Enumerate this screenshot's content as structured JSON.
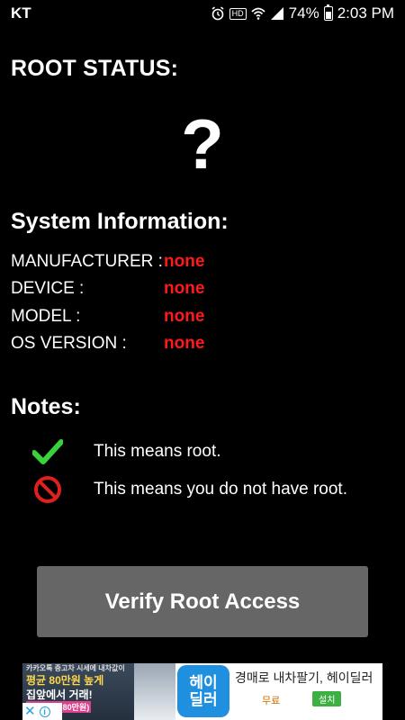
{
  "status_bar": {
    "carrier": "KT",
    "hd_label": "HD",
    "battery_percent": "74%",
    "battery_level": 0.74,
    "time": "2:03 PM"
  },
  "root_status": {
    "title": "ROOT STATUS:",
    "symbol": "?"
  },
  "system_info": {
    "title": "System Information:",
    "rows": [
      {
        "key": "MANUFACTURER :",
        "value": "none"
      },
      {
        "key": "DEVICE :",
        "value": "none"
      },
      {
        "key": "MODEL :",
        "value": "none"
      },
      {
        "key": "OS VERSION :",
        "value": "none"
      }
    ]
  },
  "notes": {
    "title": "Notes:",
    "items": [
      {
        "icon": "green-check-icon",
        "text": "This means root."
      },
      {
        "icon": "red-prohibited-icon",
        "text": "This means you do not have root."
      }
    ]
  },
  "verify_button": {
    "label": "Verify Root Access"
  },
  "ad": {
    "thumb_line1": "카카오톡 중고차 시세에 내차값이",
    "thumb_line2": "평균 80만원 높게",
    "thumb_line3": "집앞에서 거래!",
    "thumb_line4": "(평균가격 80만원)",
    "logo_line1": "헤이",
    "logo_line2": "딜러",
    "headline": "경매로 내차팔기, 헤이딜러",
    "price_label": "무료",
    "install_label": "설치"
  },
  "colors": {
    "background": "#000000",
    "value_red": "#ff1a1a",
    "check_green": "#3bd13b",
    "prohibited_red": "#e0201a",
    "button_gray": "#666666"
  }
}
